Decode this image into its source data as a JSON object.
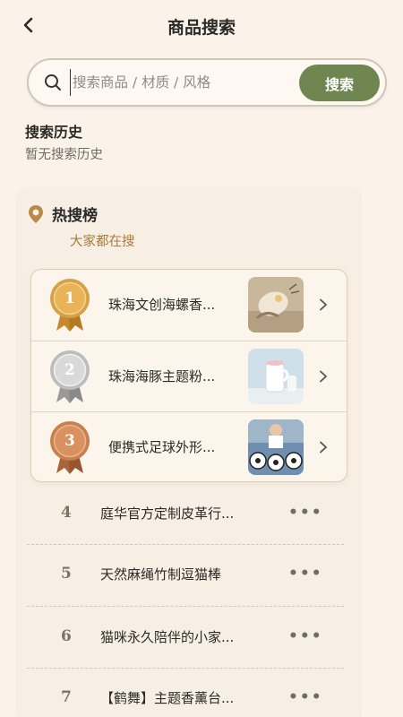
{
  "header": {
    "title": "商品搜索",
    "back_icon": "chevron-left-icon"
  },
  "search": {
    "placeholder": "搜索商品 / 材质 / 风格",
    "value": "",
    "button_label": "搜索",
    "icon": "search-icon"
  },
  "history": {
    "title": "搜索历史",
    "empty_text": "暂无搜索历史"
  },
  "hot": {
    "icon": "location-pin-icon",
    "title": "热搜榜",
    "subtitle": "大家都在搜",
    "top3": [
      {
        "rank": "1",
        "name": "珠海文创海螺香...",
        "medal": "gold-medal-icon",
        "thumb": "cream-shell-product-image"
      },
      {
        "rank": "2",
        "name": "珠海海豚主题粉...",
        "medal": "silver-medal-icon",
        "thumb": "white-cup-product-image"
      },
      {
        "rank": "3",
        "name": "便携式足球外形...",
        "medal": "bronze-medal-icon",
        "thumb": "soccer-fan-product-image"
      }
    ],
    "list": [
      {
        "rank": "4",
        "name": "庭华官方定制皮革行...",
        "more": "•••"
      },
      {
        "rank": "5",
        "name": "天然麻绳竹制逗猫棒",
        "more": "•••"
      },
      {
        "rank": "6",
        "name": "猫咪永久陪伴的小家...",
        "more": "•••"
      },
      {
        "rank": "7",
        "name": "【鹤舞】主题香薰台...",
        "more": "•••"
      }
    ]
  },
  "colors": {
    "accent": "#6f8651",
    "background": "#fbf3e9",
    "subtitle": "#a87b3c"
  }
}
